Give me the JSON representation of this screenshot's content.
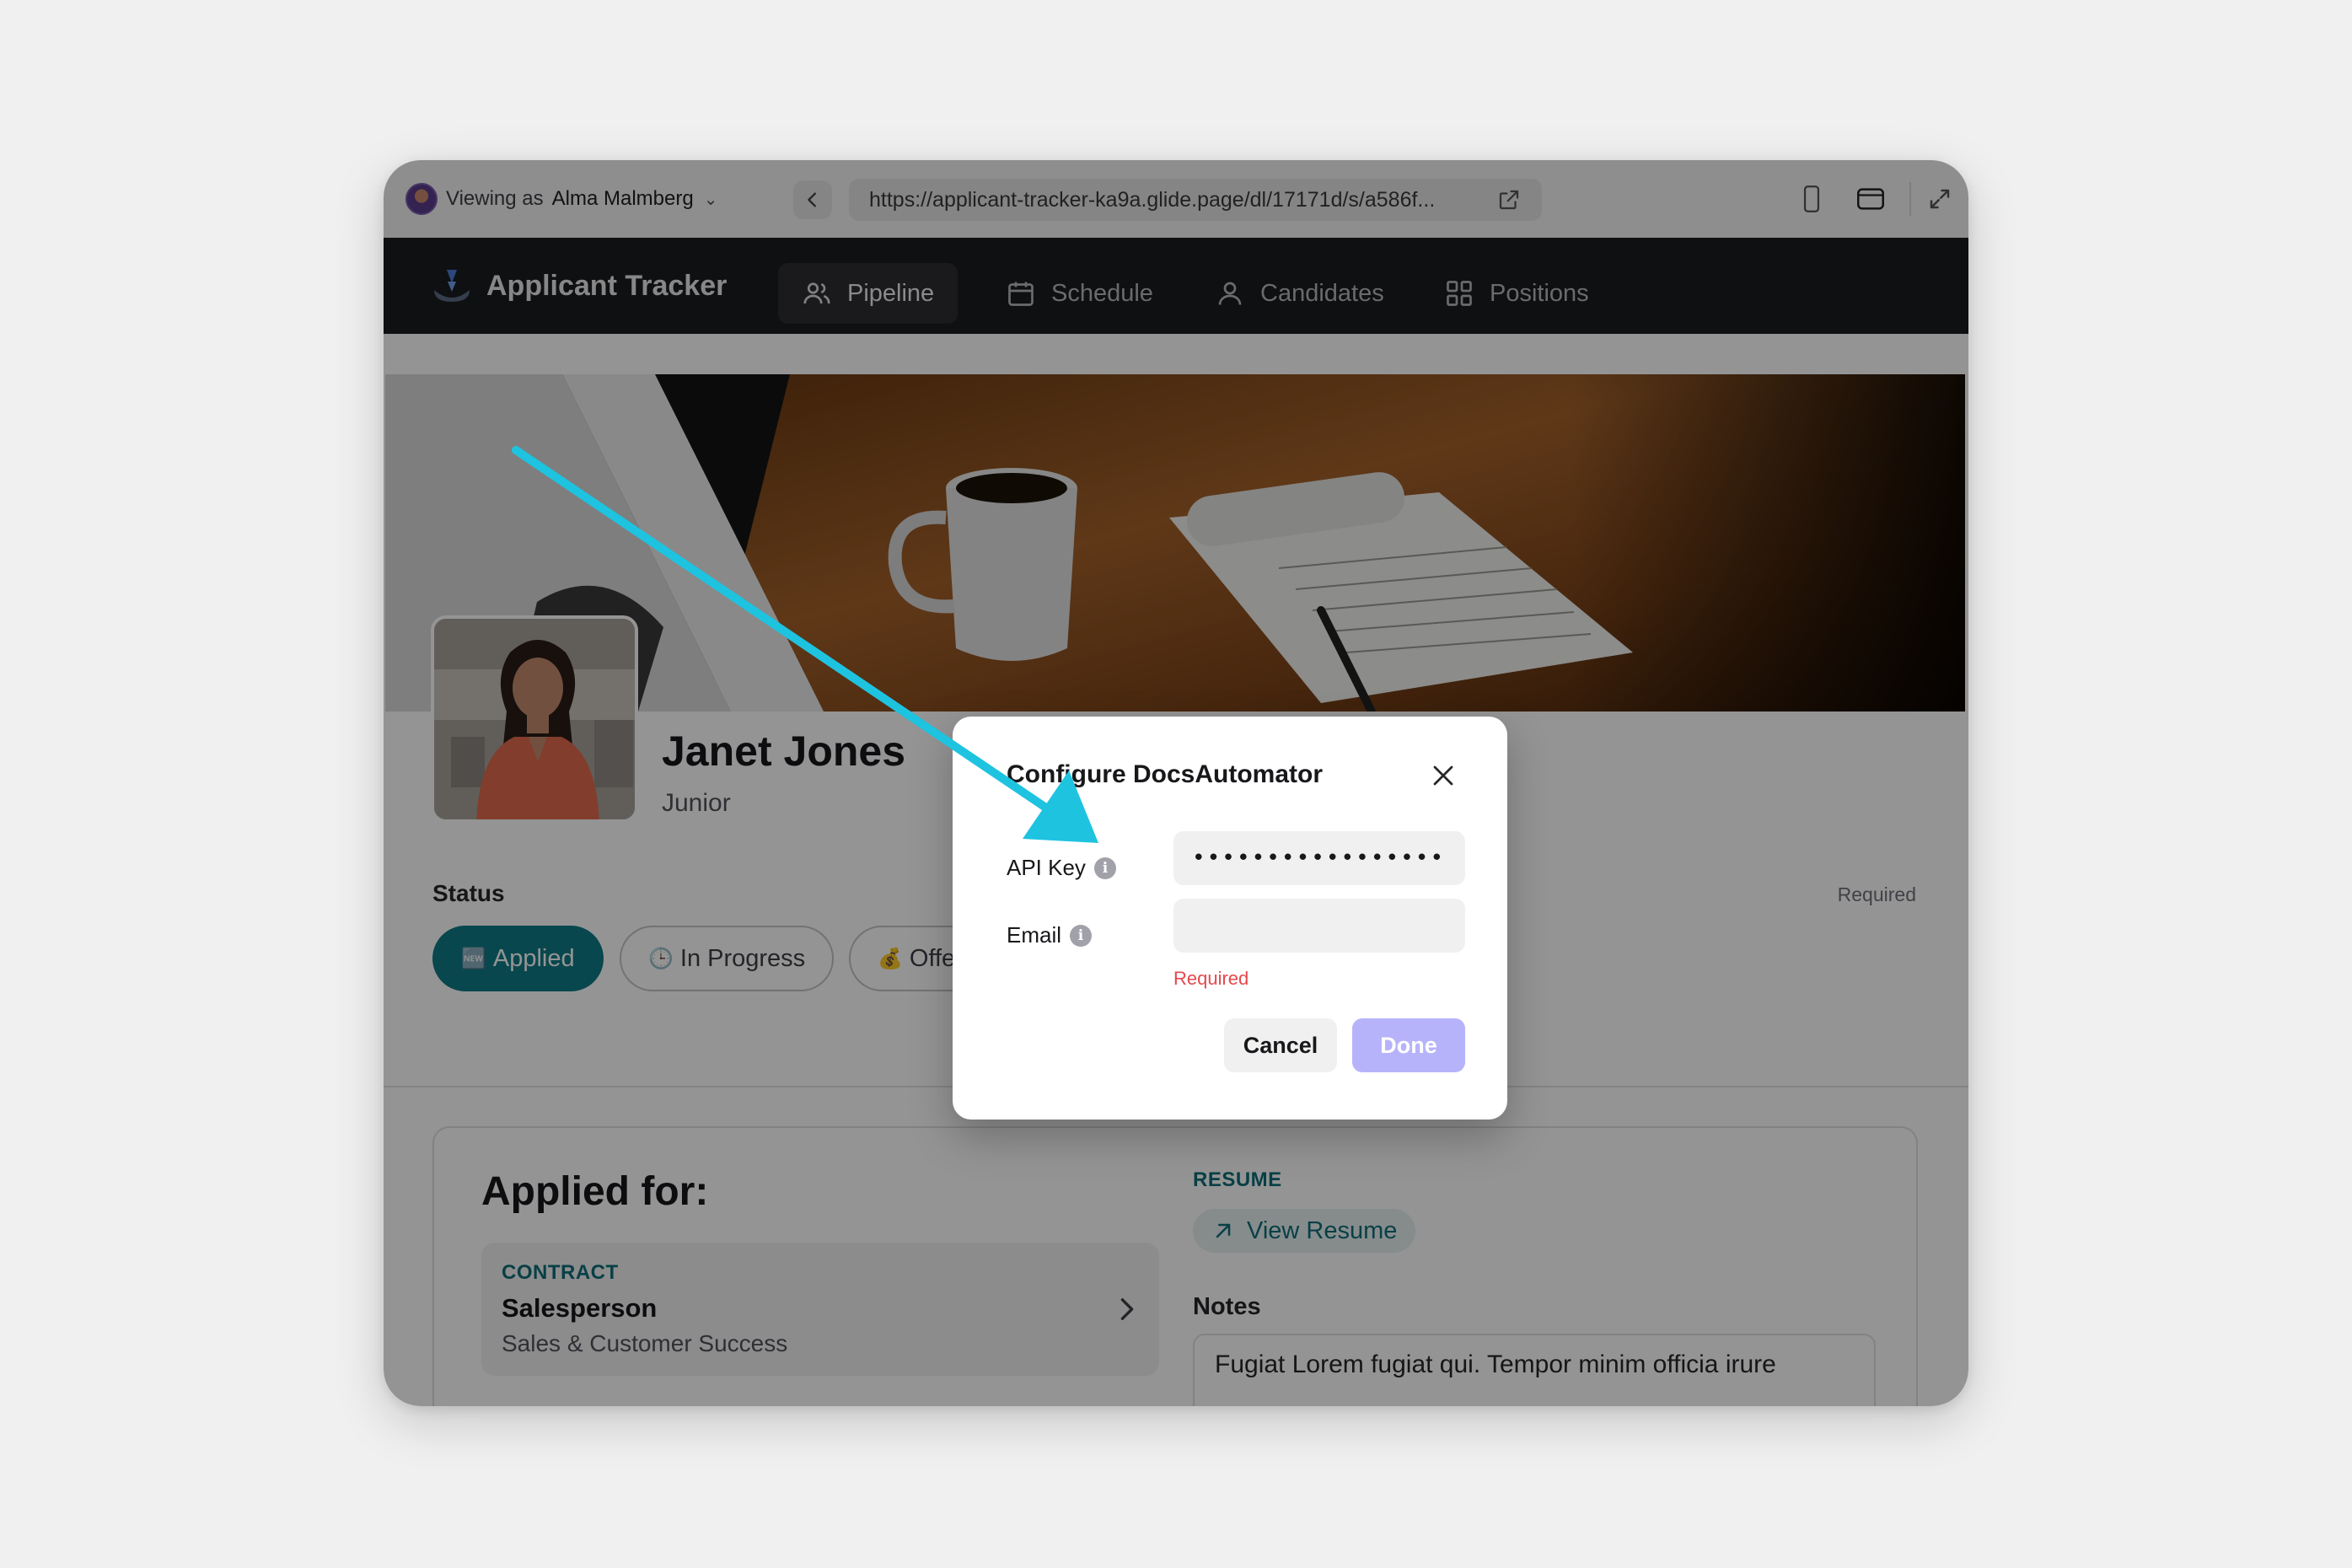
{
  "browser": {
    "viewing_prefix": "Viewing as",
    "viewing_user": "Alma Malmberg",
    "url": "https://applicant-tracker-ka9a.glide.page/dl/17171d/s/a586f..."
  },
  "app": {
    "name": "Applicant Tracker",
    "tabs": [
      {
        "label": "Pipeline",
        "icon": "users-icon",
        "active": true
      },
      {
        "label": "Schedule",
        "icon": "calendar-icon",
        "active": false
      },
      {
        "label": "Candidates",
        "icon": "person-icon",
        "active": false
      },
      {
        "label": "Positions",
        "icon": "grid-icon",
        "active": false
      }
    ]
  },
  "profile": {
    "name": "Janet Jones",
    "level": "Junior"
  },
  "status": {
    "label": "Status",
    "required": "Required",
    "chips": [
      {
        "emoji": "🆕",
        "label": "Applied",
        "active": true
      },
      {
        "emoji": "🕒",
        "label": "In Progress",
        "active": false
      },
      {
        "emoji": "💰",
        "label": "Offe",
        "active": false
      }
    ]
  },
  "applied": {
    "title": "Applied for:",
    "position_type": "CONTRACT",
    "position_title": "Salesperson",
    "position_dept": "Sales & Customer Success",
    "resume_label": "RESUME",
    "resume_button": "View Resume",
    "notes_label": "Notes",
    "notes_text": "Fugiat Lorem fugiat qui. Tempor minim officia irure"
  },
  "modal": {
    "title": "Configure DocsAutomator",
    "api_key_label": "API Key",
    "api_key_value": "••••••••••••••••••••",
    "email_label": "Email",
    "email_value": "",
    "email_error": "Required",
    "cancel": "Cancel",
    "done": "Done"
  },
  "colors": {
    "accent_teal": "#0f7b86",
    "done_button": "#b7b3fb",
    "error": "#e5484d",
    "arrow": "#1ec3e0",
    "nav_bg": "#1b1c20"
  }
}
